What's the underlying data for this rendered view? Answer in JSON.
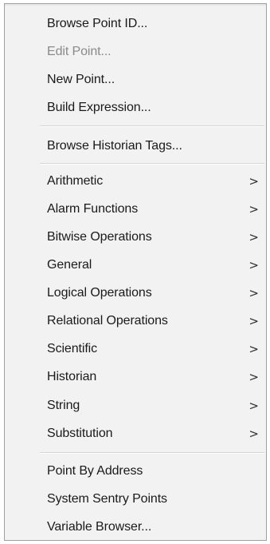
{
  "menu": {
    "group1": [
      {
        "label": "Browse Point ID...",
        "disabled": false
      },
      {
        "label": "Edit Point...",
        "disabled": true
      },
      {
        "label": "New Point...",
        "disabled": false
      },
      {
        "label": "Build Expression...",
        "disabled": false
      }
    ],
    "group2": [
      {
        "label": "Browse Historian Tags...",
        "disabled": false
      }
    ],
    "group3": [
      {
        "label": "Arithmetic",
        "submenu": true
      },
      {
        "label": "Alarm Functions",
        "submenu": true
      },
      {
        "label": "Bitwise Operations",
        "submenu": true
      },
      {
        "label": "General",
        "submenu": true
      },
      {
        "label": "Logical Operations",
        "submenu": true
      },
      {
        "label": "Relational Operations",
        "submenu": true
      },
      {
        "label": "Scientific",
        "submenu": true
      },
      {
        "label": "Historian",
        "submenu": true
      },
      {
        "label": "String",
        "submenu": true
      },
      {
        "label": "Substitution",
        "submenu": true
      }
    ],
    "group4": [
      {
        "label": "Point By Address",
        "disabled": false
      },
      {
        "label": "System Sentry Points",
        "disabled": false
      },
      {
        "label": "Variable Browser...",
        "disabled": false
      }
    ],
    "submenu_arrow": ">"
  }
}
